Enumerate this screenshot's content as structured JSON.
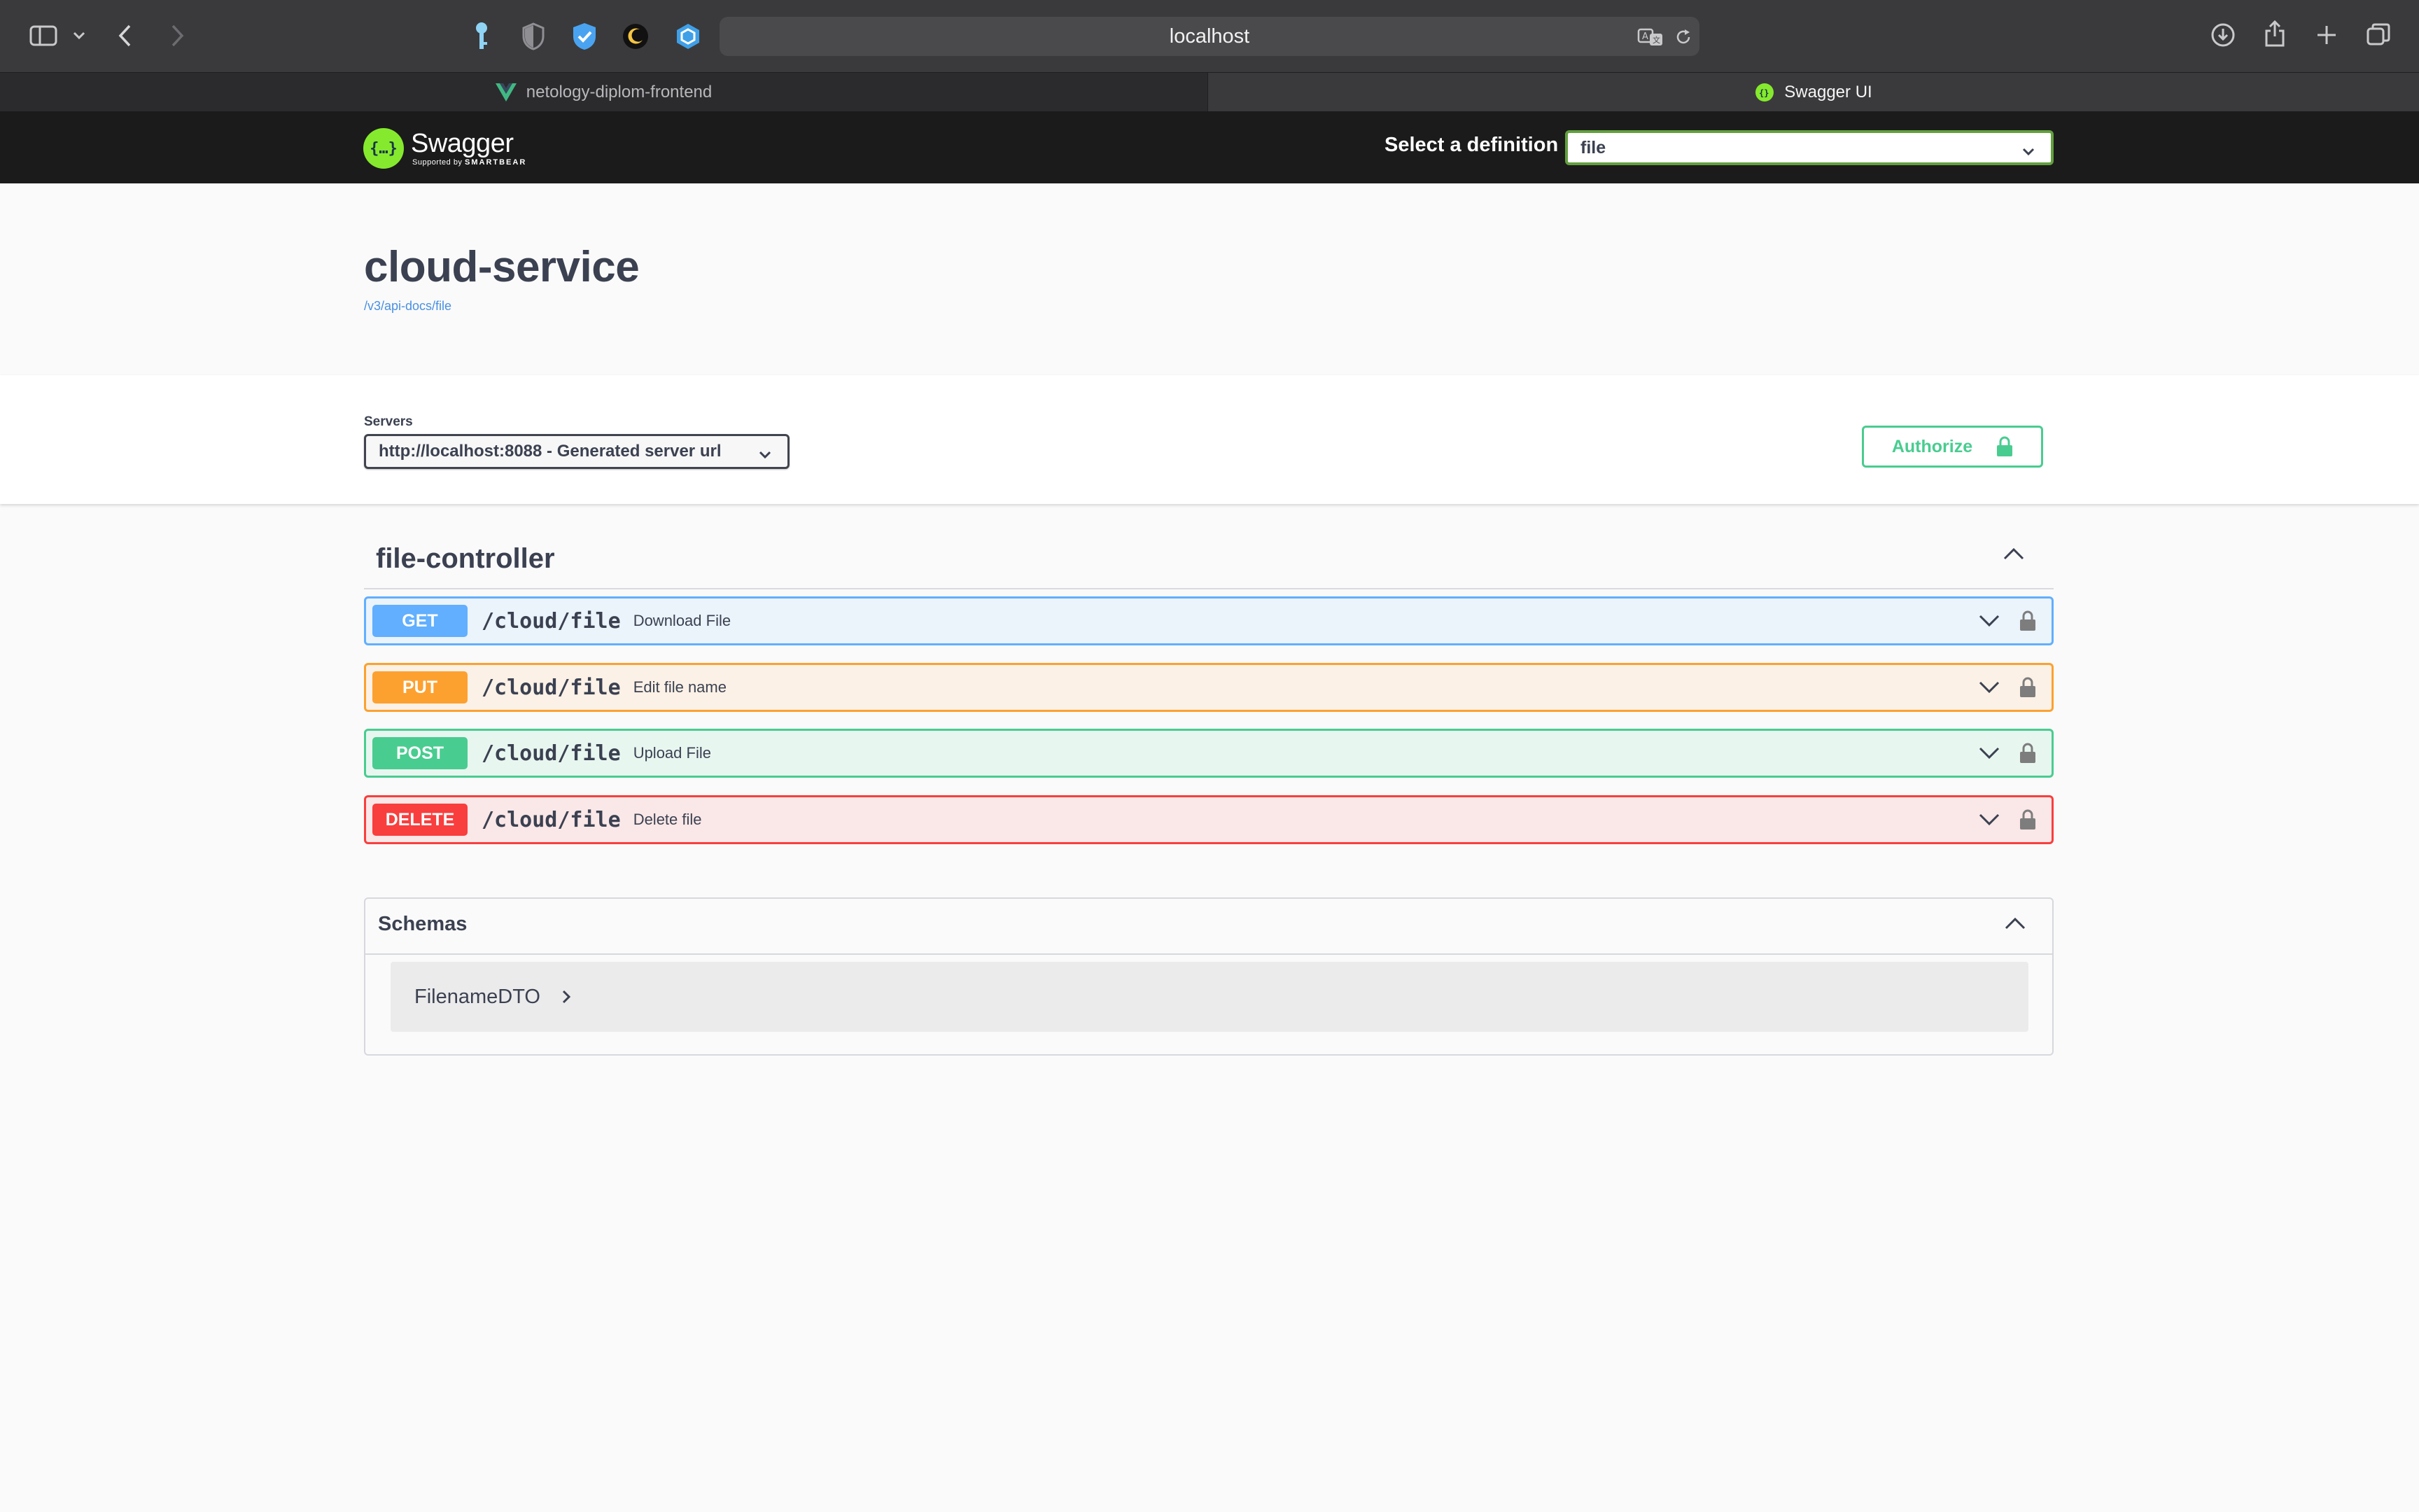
{
  "browser": {
    "address": "localhost",
    "tabs": [
      {
        "label": "netology-diplom-frontend"
      },
      {
        "label": "Swagger UI"
      }
    ]
  },
  "swagger": {
    "logo_name": "Swagger",
    "logo_tagline_prefix": "Supported by",
    "logo_tagline_brand": "SMARTBEAR",
    "definition_label": "Select a definition",
    "definition_value": "file",
    "title": "cloud-service",
    "spec_url": "/v3/api-docs/file",
    "servers_label": "Servers",
    "server_value": "http://localhost:8088 - Generated server url",
    "authorize_label": "Authorize",
    "tag": "file-controller",
    "operations": [
      {
        "method": "GET",
        "path": "/cloud/file",
        "summary": "Download File"
      },
      {
        "method": "PUT",
        "path": "/cloud/file",
        "summary": "Edit file name"
      },
      {
        "method": "POST",
        "path": "/cloud/file",
        "summary": "Upload File"
      },
      {
        "method": "DELETE",
        "path": "/cloud/file",
        "summary": "Delete file"
      }
    ],
    "schemas_title": "Schemas",
    "schemas": [
      {
        "name": "FilenameDTO"
      }
    ]
  },
  "colors": {
    "get": "#61affe",
    "put": "#fca130",
    "post": "#49cc90",
    "delete": "#f93e3e",
    "swagger_green": "#85ea2d"
  }
}
